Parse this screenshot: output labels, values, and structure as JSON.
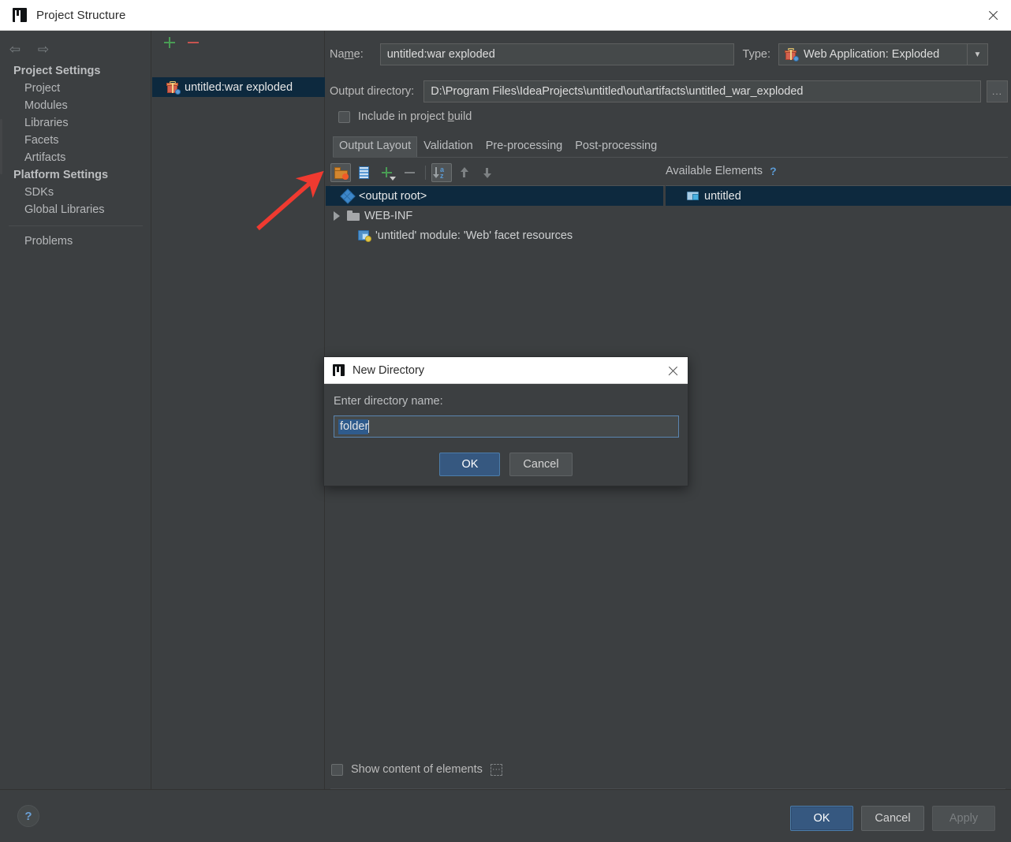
{
  "window": {
    "title": "Project Structure",
    "icon": "intellij-logo-icon",
    "close_label": "×"
  },
  "sidebar": {
    "nav": {
      "back": "⇦",
      "forward": "⇨"
    },
    "groups": [
      {
        "label": "Project Settings",
        "items": [
          "Project",
          "Modules",
          "Libraries",
          "Facets",
          "Artifacts"
        ]
      },
      {
        "label": "Platform Settings",
        "items": [
          "SDKs",
          "Global Libraries"
        ]
      }
    ],
    "problems_label": "Problems"
  },
  "artifacts_panel": {
    "add_label": "+",
    "remove_label": "−",
    "items": [
      {
        "label": "untitled:war exploded",
        "selected": true
      }
    ]
  },
  "editor": {
    "name_label": "Name:",
    "name_value": "untitled:war exploded",
    "type_label": "Type:",
    "type_value": "Web Application: Exploded",
    "type_arrow": "▼",
    "output_dir_label": "Output directory:",
    "output_dir_value": "D:\\Program Files\\IdeaProjects\\untitled\\out\\artifacts\\untitled_war_exploded",
    "browse_label": "...",
    "include_in_build_label": "Include in project build",
    "include_in_build_checked": false,
    "tabs": [
      {
        "label": "Output Layout",
        "active": true
      },
      {
        "label": "Validation",
        "active": false
      },
      {
        "label": "Pre-processing",
        "active": false
      },
      {
        "label": "Post-processing",
        "active": false
      }
    ],
    "toolbar": [
      {
        "name": "create-directory",
        "pressed": true
      },
      {
        "name": "create-archive",
        "pressed": false
      },
      {
        "name": "add-copy-of",
        "pressed": false
      },
      {
        "name": "remove",
        "pressed": false
      },
      {
        "name": "sort-alphabetically",
        "pressed": true
      },
      {
        "name": "move-up",
        "pressed": false
      },
      {
        "name": "move-down",
        "pressed": false
      }
    ],
    "output_tree": [
      {
        "label": "<output root>",
        "icon": "output-root-icon",
        "selected": true,
        "indent": 0,
        "expandable": false
      },
      {
        "label": "WEB-INF",
        "icon": "folder-icon",
        "selected": false,
        "indent": 1,
        "expandable": true
      },
      {
        "label": "'untitled' module: 'Web' facet resources",
        "icon": "module-facet-icon",
        "selected": false,
        "indent": 1,
        "expandable": false
      }
    ],
    "available_elements_label": "Available Elements",
    "available_help": "?",
    "available_tree": [
      {
        "label": "untitled",
        "icon": "module-icon",
        "selected": true
      }
    ],
    "show_content_label": "Show content of elements",
    "show_content_checked": false,
    "show_content_more": "···"
  },
  "dialog": {
    "title": "New Directory",
    "icon": "intellij-logo-icon",
    "close_label": "×",
    "prompt": "Enter directory name:",
    "input_value": "folder",
    "ok_label": "OK",
    "cancel_label": "Cancel"
  },
  "footer": {
    "help_label": "?",
    "ok_label": "OK",
    "cancel_label": "Cancel",
    "apply_label": "Apply"
  },
  "annotation": {
    "arrow_color": "#f03a30"
  },
  "colors": {
    "background": "#3c3f41",
    "selection": "#0d293e",
    "accent_blue": "#365880",
    "title_bar": "#ffffff",
    "text": "#bcbec0"
  }
}
